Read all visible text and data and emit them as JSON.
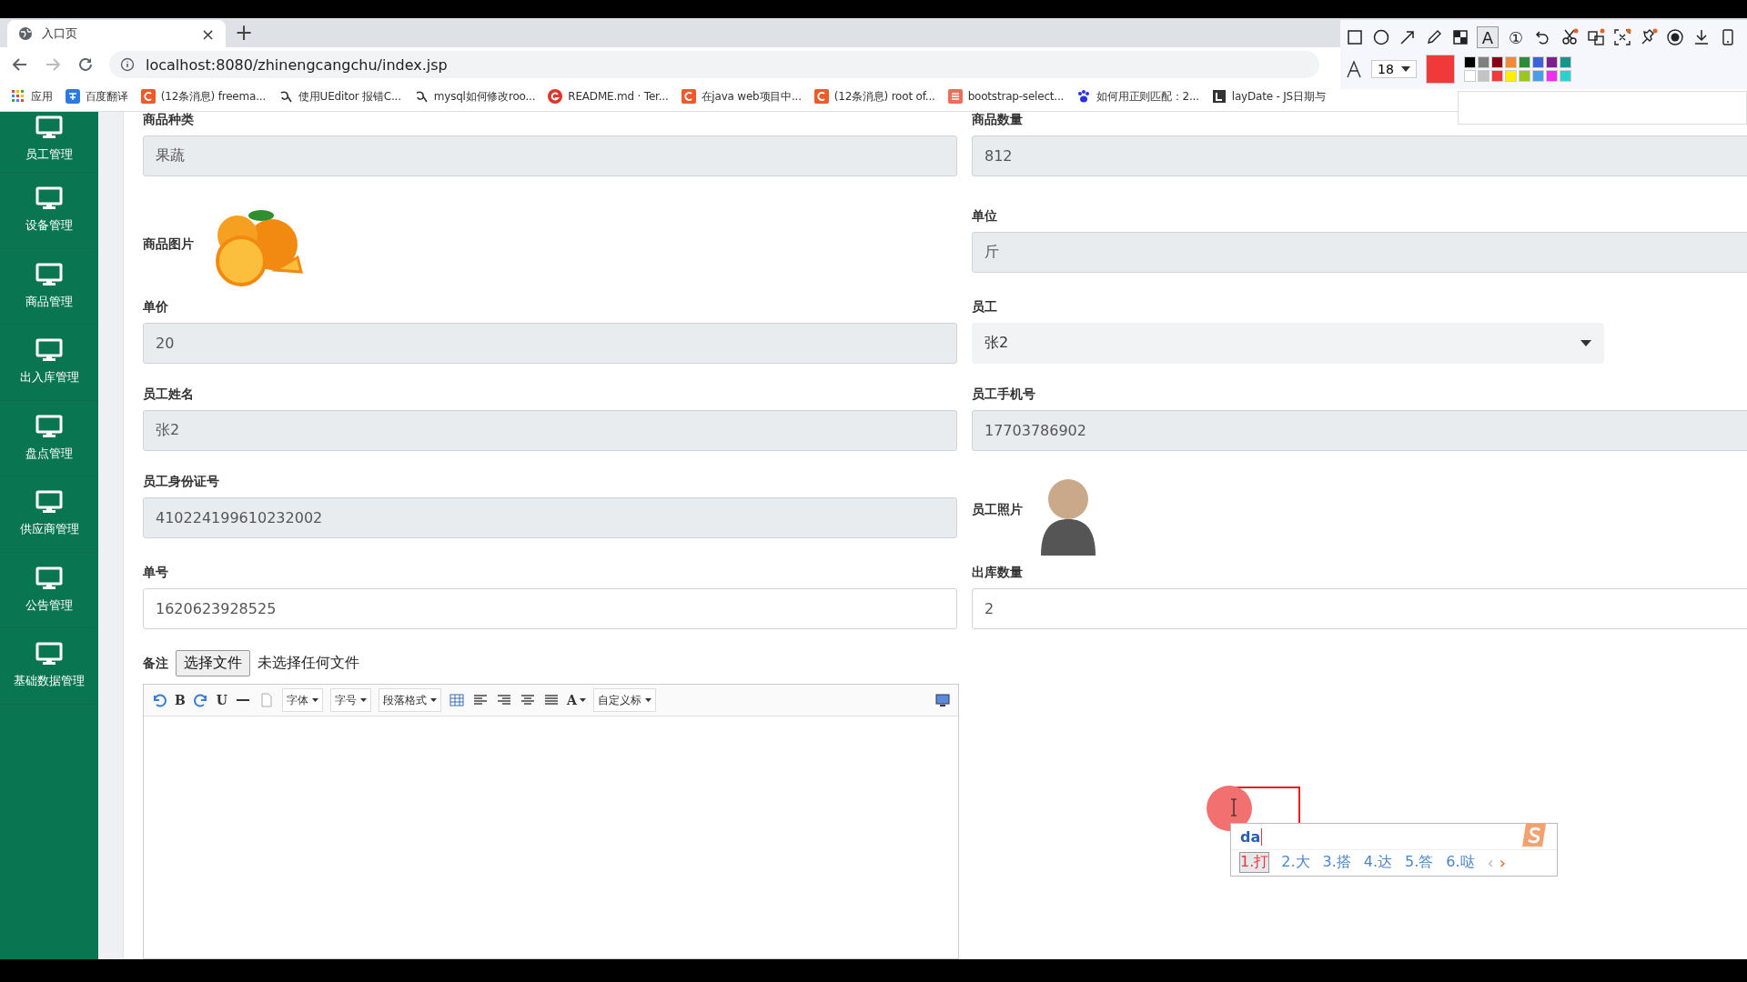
{
  "browser": {
    "tab": {
      "title": "入口页",
      "close": "×"
    },
    "new_tab": "+",
    "url": "localhost:8080/zhinengcangchu/index.jsp",
    "bookmarks": [
      {
        "label": "应用",
        "kind": "apps"
      },
      {
        "label": "百度翻译",
        "kind": "translate"
      },
      {
        "label": "(12条消息) freema...",
        "kind": "c"
      },
      {
        "label": "使用UEditor 报错C...",
        "kind": "hook"
      },
      {
        "label": "mysql如何修改roo...",
        "kind": "hook"
      },
      {
        "label": "README.md · Ter...",
        "kind": "g"
      },
      {
        "label": "在java web项目中...",
        "kind": "c"
      },
      {
        "label": "(12条消息) root of...",
        "kind": "c"
      },
      {
        "label": "bootstrap-select...",
        "kind": "jian"
      },
      {
        "label": "如何用正则匹配：2...",
        "kind": "paw"
      },
      {
        "label": "layDate - JS日期与",
        "kind": "book"
      }
    ]
  },
  "sidebar": {
    "items": [
      {
        "label": "员工管理"
      },
      {
        "label": "设备管理"
      },
      {
        "label": "商品管理"
      },
      {
        "label": "出入库管理"
      },
      {
        "label": "盘点管理"
      },
      {
        "label": "供应商管理"
      },
      {
        "label": "公告管理"
      },
      {
        "label": "基础数据管理"
      }
    ]
  },
  "form": {
    "rows": [
      [
        {
          "label": "商品种类",
          "kind": "readonly",
          "value": "果蔬"
        },
        {
          "label": "商品数量",
          "kind": "readonly",
          "value": "812"
        }
      ],
      [
        {
          "label": "商品图片",
          "kind": "photo"
        },
        {
          "label": "单位",
          "kind": "readonly",
          "value": "斤"
        }
      ],
      [
        {
          "label": "单价",
          "kind": "readonly",
          "value": "20"
        },
        {
          "label": "员工",
          "kind": "select",
          "value": "张2"
        }
      ],
      [
        {
          "label": "员工姓名",
          "kind": "readonly",
          "value": "张2"
        },
        {
          "label": "员工手机号",
          "kind": "readonly",
          "value": "17703786902"
        }
      ],
      [
        {
          "label": "员工身份证号",
          "kind": "readonly",
          "value": "410224199610232002"
        },
        {
          "label": "员工照片",
          "kind": "avatar"
        }
      ],
      [
        {
          "label": "单号",
          "kind": "input",
          "value": "1620623928525"
        },
        {
          "label": "出库数量",
          "kind": "input",
          "value": "2"
        }
      ]
    ],
    "notes": {
      "label": "备注",
      "file_button": "选择文件",
      "file_status": "未选择任何文件"
    },
    "editor_toolbar": [
      {
        "kind": "undo"
      },
      {
        "kind": "glyph",
        "text": "B"
      },
      {
        "kind": "redo"
      },
      {
        "kind": "glyph",
        "text": "U"
      },
      {
        "kind": "rule"
      },
      {
        "kind": "page"
      },
      {
        "kind": "dropdown",
        "text": "字体"
      },
      {
        "kind": "dropdown",
        "text": "字号"
      },
      {
        "kind": "dropdown",
        "text": "段落格式"
      },
      {
        "kind": "table"
      },
      {
        "kind": "align-left"
      },
      {
        "kind": "align-right"
      },
      {
        "kind": "align-center"
      },
      {
        "kind": "justify"
      },
      {
        "kind": "color",
        "text": "A"
      },
      {
        "kind": "dropdown",
        "text": "自定义标"
      },
      {
        "kind": "monitor"
      }
    ]
  },
  "capture_toolbar": {
    "tools": [
      {
        "kind": "rect",
        "selected": false
      },
      {
        "kind": "circle",
        "selected": false
      },
      {
        "kind": "arrow",
        "selected": false
      },
      {
        "kind": "pencil",
        "selected": false
      },
      {
        "kind": "mosaic",
        "selected": false
      },
      {
        "kind": "glyph",
        "text": "A",
        "selected": true
      },
      {
        "kind": "glyph",
        "text": "①",
        "selected": false
      },
      {
        "kind": "undo",
        "selected": false
      },
      {
        "kind": "scissors",
        "selected": false
      },
      {
        "kind": "translate",
        "selected": false
      },
      {
        "kind": "ocr",
        "selected": false
      },
      {
        "kind": "pin",
        "selected": false
      },
      {
        "kind": "record",
        "selected": false
      },
      {
        "kind": "download",
        "selected": false
      },
      {
        "kind": "phone",
        "selected": false
      }
    ],
    "font_size": "18",
    "current": {
      "color": "#f03a3a"
    },
    "palette": [
      {
        "color": "#000000"
      },
      {
        "color": "#7f7f7f"
      },
      {
        "color": "#880015"
      },
      {
        "color": "#ef8a3c"
      },
      {
        "color": "#2e8b3a"
      },
      {
        "color": "#3f62d8"
      },
      {
        "color": "#7f1f8f"
      },
      {
        "color": "#19948c"
      },
      {
        "color": "#ffffff"
      },
      {
        "color": "#c3c3c3"
      },
      {
        "color": "#f03a3a"
      },
      {
        "color": "#ffee00"
      },
      {
        "color": "#9ac61e"
      },
      {
        "color": "#4a9ee8"
      },
      {
        "color": "#ee30ee"
      },
      {
        "color": "#2ed0d0"
      }
    ]
  },
  "ime": {
    "input": "da",
    "candidates": [
      {
        "text": "1.打",
        "selected": true
      },
      {
        "text": "2.大",
        "selected": false
      },
      {
        "text": "3.搭",
        "selected": false
      },
      {
        "text": "4.达",
        "selected": false
      },
      {
        "text": "5.答",
        "selected": false
      },
      {
        "text": "6.哒",
        "selected": false
      }
    ],
    "prev": "‹",
    "next": "›"
  }
}
